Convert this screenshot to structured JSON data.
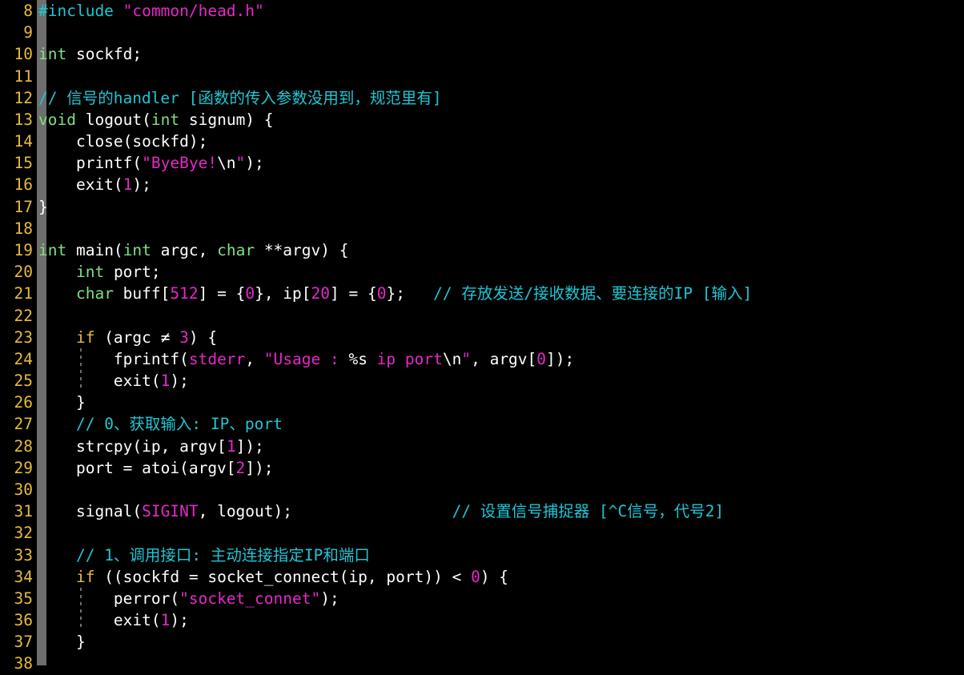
{
  "editor": {
    "name": "code-editor",
    "language": "c",
    "background_color": "#000000",
    "gutter_bar_color": "#6e6e6e",
    "first_line_number": 8,
    "last_line_number": 38,
    "colors": {
      "line_number": "#e8bb3a",
      "keyword_type": "#7ee081",
      "keyword_control": "#e8bb3a",
      "string": "#e628c8",
      "escape": "#ffffff",
      "number": "#e628c8",
      "constant": "#e628c8",
      "comment": "#20c5d4",
      "preprocessor": "#20c5d4",
      "plain_text": "#ffffff",
      "indent_guide": "#6e6e6e"
    }
  },
  "lines": [
    {
      "num": "8",
      "indent_guide": false,
      "text": "#include \"common/head.h\"",
      "tokens": [
        {
          "t": "#include",
          "c": "tok-pre"
        },
        {
          "t": " ",
          "c": "tok-plain"
        },
        {
          "t": "\"common/head.h\"",
          "c": "tok-str"
        }
      ]
    },
    {
      "num": "9",
      "indent_guide": false,
      "text": "",
      "tokens": []
    },
    {
      "num": "10",
      "indent_guide": false,
      "text": "int sockfd;",
      "tokens": [
        {
          "t": "int",
          "c": "tok-kw"
        },
        {
          "t": " sockfd;",
          "c": "tok-plain"
        }
      ]
    },
    {
      "num": "11",
      "indent_guide": false,
      "text": "",
      "tokens": []
    },
    {
      "num": "12",
      "indent_guide": false,
      "text": "// 信号的handler [函数的传入参数没用到，规范里有]",
      "tokens": [
        {
          "t": "// 信号的handler [函数的传入参数没用到，规范里有]",
          "c": "tok-comment"
        }
      ]
    },
    {
      "num": "13",
      "indent_guide": false,
      "text": "void logout(int signum) {",
      "tokens": [
        {
          "t": "void",
          "c": "tok-kw"
        },
        {
          "t": " logout(",
          "c": "tok-plain"
        },
        {
          "t": "int",
          "c": "tok-kw"
        },
        {
          "t": " signum) {",
          "c": "tok-plain"
        }
      ]
    },
    {
      "num": "14",
      "indent_guide": false,
      "text": "    close(sockfd);",
      "tokens": [
        {
          "t": "    close(sockfd);",
          "c": "tok-plain"
        }
      ]
    },
    {
      "num": "15",
      "indent_guide": false,
      "text": "    printf(\"ByeBye!\\n\");",
      "tokens": [
        {
          "t": "    printf(",
          "c": "tok-plain"
        },
        {
          "t": "\"ByeBye!",
          "c": "tok-str"
        },
        {
          "t": "\\n",
          "c": "tok-esc"
        },
        {
          "t": "\"",
          "c": "tok-str"
        },
        {
          "t": ");",
          "c": "tok-plain"
        }
      ]
    },
    {
      "num": "16",
      "indent_guide": false,
      "text": "    exit(1);",
      "tokens": [
        {
          "t": "    exit(",
          "c": "tok-plain"
        },
        {
          "t": "1",
          "c": "tok-num"
        },
        {
          "t": ");",
          "c": "tok-plain"
        }
      ]
    },
    {
      "num": "17",
      "indent_guide": false,
      "text": "}",
      "tokens": [
        {
          "t": "}",
          "c": "tok-plain"
        }
      ]
    },
    {
      "num": "18",
      "indent_guide": false,
      "text": "",
      "tokens": []
    },
    {
      "num": "19",
      "indent_guide": false,
      "text": "int main(int argc, char **argv) {",
      "tokens": [
        {
          "t": "int",
          "c": "tok-kw"
        },
        {
          "t": " main(",
          "c": "tok-plain"
        },
        {
          "t": "int",
          "c": "tok-kw"
        },
        {
          "t": " argc, ",
          "c": "tok-plain"
        },
        {
          "t": "char",
          "c": "tok-kw"
        },
        {
          "t": " **argv) {",
          "c": "tok-plain"
        }
      ]
    },
    {
      "num": "20",
      "indent_guide": false,
      "text": "    int port;",
      "tokens": [
        {
          "t": "    ",
          "c": "tok-plain"
        },
        {
          "t": "int",
          "c": "tok-kw"
        },
        {
          "t": " port;",
          "c": "tok-plain"
        }
      ]
    },
    {
      "num": "21",
      "indent_guide": false,
      "text": "    char buff[512] = {0}, ip[20] = {0};   // 存放发送/接收数据、要连接的IP [输入]",
      "tokens": [
        {
          "t": "    ",
          "c": "tok-plain"
        },
        {
          "t": "char",
          "c": "tok-kw"
        },
        {
          "t": " buff[",
          "c": "tok-plain"
        },
        {
          "t": "512",
          "c": "tok-num"
        },
        {
          "t": "] = {",
          "c": "tok-plain"
        },
        {
          "t": "0",
          "c": "tok-num"
        },
        {
          "t": "}, ip[",
          "c": "tok-plain"
        },
        {
          "t": "20",
          "c": "tok-num"
        },
        {
          "t": "] = {",
          "c": "tok-plain"
        },
        {
          "t": "0",
          "c": "tok-num"
        },
        {
          "t": "};   ",
          "c": "tok-plain"
        },
        {
          "t": "// 存放发送/接收数据、要连接的IP [输入]",
          "c": "tok-comment"
        }
      ]
    },
    {
      "num": "22",
      "indent_guide": false,
      "text": "",
      "tokens": []
    },
    {
      "num": "23",
      "indent_guide": false,
      "text": "    if (argc ≠ 3) {",
      "tokens": [
        {
          "t": "    ",
          "c": "tok-plain"
        },
        {
          "t": "if",
          "c": "tok-ctrl"
        },
        {
          "t": " (argc ≠ ",
          "c": "tok-plain"
        },
        {
          "t": "3",
          "c": "tok-num"
        },
        {
          "t": ") {",
          "c": "tok-plain"
        }
      ]
    },
    {
      "num": "24",
      "indent_guide": true,
      "text": "        fprintf(stderr, \"Usage : %s ip port\\n\", argv[0]);",
      "tokens": [
        {
          "t": "        fprintf(",
          "c": "tok-plain"
        },
        {
          "t": "stderr",
          "c": "tok-const"
        },
        {
          "t": ", ",
          "c": "tok-plain"
        },
        {
          "t": "\"Usage : ",
          "c": "tok-str"
        },
        {
          "t": "%s",
          "c": "tok-esc"
        },
        {
          "t": " ip port",
          "c": "tok-str"
        },
        {
          "t": "\\n",
          "c": "tok-esc"
        },
        {
          "t": "\"",
          "c": "tok-str"
        },
        {
          "t": ", argv[",
          "c": "tok-plain"
        },
        {
          "t": "0",
          "c": "tok-num"
        },
        {
          "t": "]);",
          "c": "tok-plain"
        }
      ]
    },
    {
      "num": "25",
      "indent_guide": true,
      "text": "        exit(1);",
      "tokens": [
        {
          "t": "        exit(",
          "c": "tok-plain"
        },
        {
          "t": "1",
          "c": "tok-num"
        },
        {
          "t": ");",
          "c": "tok-plain"
        }
      ]
    },
    {
      "num": "26",
      "indent_guide": false,
      "text": "    }",
      "tokens": [
        {
          "t": "    }",
          "c": "tok-plain"
        }
      ]
    },
    {
      "num": "27",
      "indent_guide": false,
      "text": "    // 0、获取输入: IP、port",
      "tokens": [
        {
          "t": "    ",
          "c": "tok-plain"
        },
        {
          "t": "// 0、获取输入: IP、port",
          "c": "tok-comment"
        }
      ]
    },
    {
      "num": "28",
      "indent_guide": false,
      "text": "    strcpy(ip, argv[1]);",
      "tokens": [
        {
          "t": "    strcpy(ip, argv[",
          "c": "tok-plain"
        },
        {
          "t": "1",
          "c": "tok-num"
        },
        {
          "t": "]);",
          "c": "tok-plain"
        }
      ]
    },
    {
      "num": "29",
      "indent_guide": false,
      "text": "    port = atoi(argv[2]);",
      "tokens": [
        {
          "t": "    port = atoi(argv[",
          "c": "tok-plain"
        },
        {
          "t": "2",
          "c": "tok-num"
        },
        {
          "t": "]);",
          "c": "tok-plain"
        }
      ]
    },
    {
      "num": "30",
      "indent_guide": false,
      "text": "",
      "tokens": []
    },
    {
      "num": "31",
      "indent_guide": false,
      "text": "    signal(SIGINT, logout);                 // 设置信号捕捉器 [^C信号，代号2]",
      "tokens": [
        {
          "t": "    signal(",
          "c": "tok-plain"
        },
        {
          "t": "SIGINT",
          "c": "tok-const"
        },
        {
          "t": ", logout);                 ",
          "c": "tok-plain"
        },
        {
          "t": "// 设置信号捕捉器 [^C信号，代号2]",
          "c": "tok-comment"
        }
      ]
    },
    {
      "num": "32",
      "indent_guide": false,
      "text": "",
      "tokens": []
    },
    {
      "num": "33",
      "indent_guide": false,
      "text": "    // 1、调用接口: 主动连接指定IP和端口",
      "tokens": [
        {
          "t": "    ",
          "c": "tok-plain"
        },
        {
          "t": "// 1、调用接口: 主动连接指定IP和端口",
          "c": "tok-comment"
        }
      ]
    },
    {
      "num": "34",
      "indent_guide": false,
      "text": "    if ((sockfd = socket_connect(ip, port)) < 0) {",
      "tokens": [
        {
          "t": "    ",
          "c": "tok-plain"
        },
        {
          "t": "if",
          "c": "tok-ctrl"
        },
        {
          "t": " ((sockfd = socket_connect(ip, port)) < ",
          "c": "tok-plain"
        },
        {
          "t": "0",
          "c": "tok-num"
        },
        {
          "t": ") {",
          "c": "tok-plain"
        }
      ]
    },
    {
      "num": "35",
      "indent_guide": true,
      "text": "        perror(\"socket_connet\");",
      "tokens": [
        {
          "t": "        perror(",
          "c": "tok-plain"
        },
        {
          "t": "\"socket_connet\"",
          "c": "tok-str"
        },
        {
          "t": ");",
          "c": "tok-plain"
        }
      ]
    },
    {
      "num": "36",
      "indent_guide": true,
      "text": "        exit(1);",
      "tokens": [
        {
          "t": "        exit(",
          "c": "tok-plain"
        },
        {
          "t": "1",
          "c": "tok-num"
        },
        {
          "t": ");",
          "c": "tok-plain"
        }
      ]
    },
    {
      "num": "37",
      "indent_guide": false,
      "text": "    }",
      "tokens": [
        {
          "t": "    }",
          "c": "tok-plain"
        }
      ]
    },
    {
      "num": "38",
      "indent_guide": false,
      "text": "",
      "tokens": []
    }
  ]
}
